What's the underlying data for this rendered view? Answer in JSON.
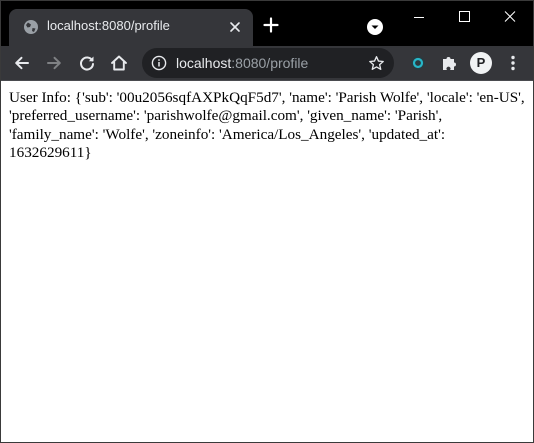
{
  "browser": {
    "tab_title": "localhost:8080/profile",
    "url_host": "localhost",
    "url_rest": ":8080/profile",
    "profile_initial": "P"
  },
  "page": {
    "body_text": "User Info: {'sub': '00u2056sqfAXPkQqF5d7', 'name': 'Parish Wolfe', 'locale': 'en-US', 'preferred_username': 'parishwolfe@gmail.com', 'given_name': 'Parish', 'family_name': 'Wolfe', 'zoneinfo': 'America/Los_Angeles', 'updated_at': 1632629611}"
  },
  "colors": {
    "frame": "#000000",
    "toolbar": "#35363a",
    "omnibox": "#202124",
    "text_light": "#e8eaed",
    "text_dim": "#9aa0a6",
    "page_bg": "#ffffff"
  }
}
